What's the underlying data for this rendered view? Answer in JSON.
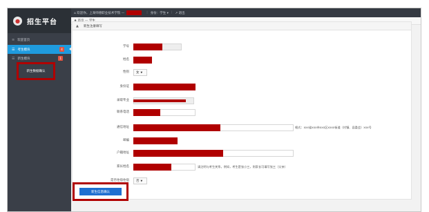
{
  "brand": {
    "icon": "●",
    "title": "招生平台"
  },
  "sidebar": {
    "items": [
      {
        "label": "欢迎首页"
      },
      {
        "label": "考生模块",
        "badge": "4"
      },
      {
        "label": "新生模块",
        "badge": "1"
      }
    ],
    "sub_item": "新生数据确认"
  },
  "topbar": {
    "welcome": "⌂ 欢迎你，上海师德职业技术学院 —",
    "role": "身份：学生 ▾",
    "logout": "↗ 退出"
  },
  "breadcrumb": "♠ 首页 — 学生",
  "panel": {
    "title": "新生注册填写",
    "caret": "▲"
  },
  "form": {
    "student_id": "学号",
    "name": "姓名",
    "gender_label": "性别",
    "gender_value": "女",
    "id_card": "身份证",
    "major": "录取专业",
    "phone": "联系电话",
    "address": "通信地址",
    "address_hint": "格式：xxx省xxx市xxx区xxxx街道（村镇、县委会）xxx号",
    "postcode": "邮编",
    "household": "户籍地址",
    "guardian": "家长姓名",
    "guardian_hint": "请注明与考生关系，例如，考生是张小三，则家长可填写张三（父亲）",
    "dorm_label": "是否住宿住宿",
    "dorm_value": "否"
  },
  "submit_label": "新生信息确认",
  "colors": {
    "sidebar": "#3a3f48",
    "active": "#1f9bde",
    "redaction": "#b00000",
    "button": "#1f6fd0"
  }
}
